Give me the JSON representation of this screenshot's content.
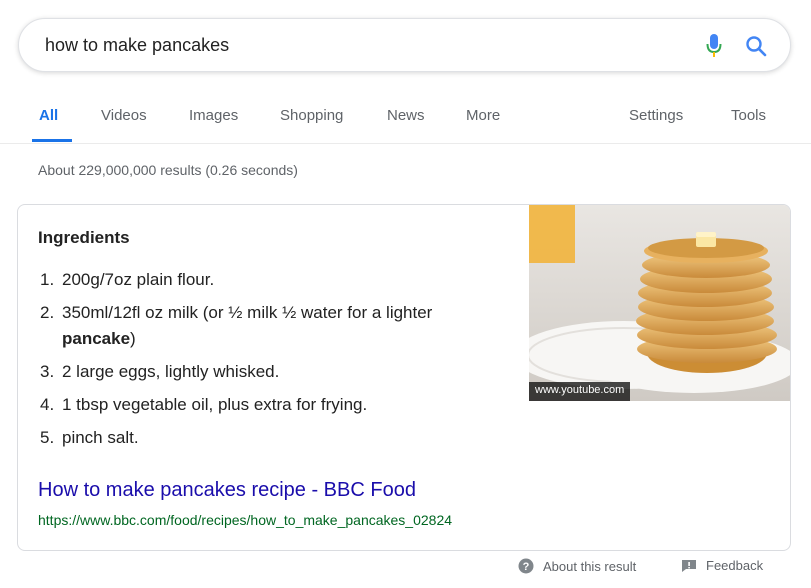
{
  "search": {
    "query": "how to make pancakes"
  },
  "tabs": [
    {
      "label": "All",
      "active": true
    },
    {
      "label": "Videos"
    },
    {
      "label": "Images"
    },
    {
      "label": "Shopping"
    },
    {
      "label": "News"
    },
    {
      "label": "More"
    },
    {
      "label": "Settings"
    },
    {
      "label": "Tools"
    }
  ],
  "stats": "About 229,000,000 results (0.26 seconds)",
  "snippet": {
    "heading": "Ingredients",
    "items": [
      {
        "num": "1.",
        "text": "200g/7oz plain flour."
      },
      {
        "num": "2.",
        "text": "350ml/12fl oz milk (or ½ milk ½ water for a lighter ",
        "bold": "pancake",
        "suffix": ")"
      },
      {
        "num": "3.",
        "text": "2 large eggs, lightly whisked."
      },
      {
        "num": "4.",
        "text": "1 tbsp vegetable oil, plus extra for frying."
      },
      {
        "num": "5.",
        "text": "pinch salt."
      }
    ],
    "image_caption": "www.youtube.com",
    "result_title": "How to make pancakes recipe - BBC Food",
    "result_url": "https://www.bbc.com/food/recipes/how_to_make_pancakes_02824"
  },
  "footer": {
    "about": "About this result",
    "feedback": "Feedback"
  },
  "colors": {
    "link": "#1a0dab",
    "url": "#006621",
    "accent": "#1a73e8"
  },
  "icons": {
    "mic": "microphone-icon",
    "search": "search-icon",
    "help": "help-icon",
    "feedback": "feedback-icon"
  }
}
